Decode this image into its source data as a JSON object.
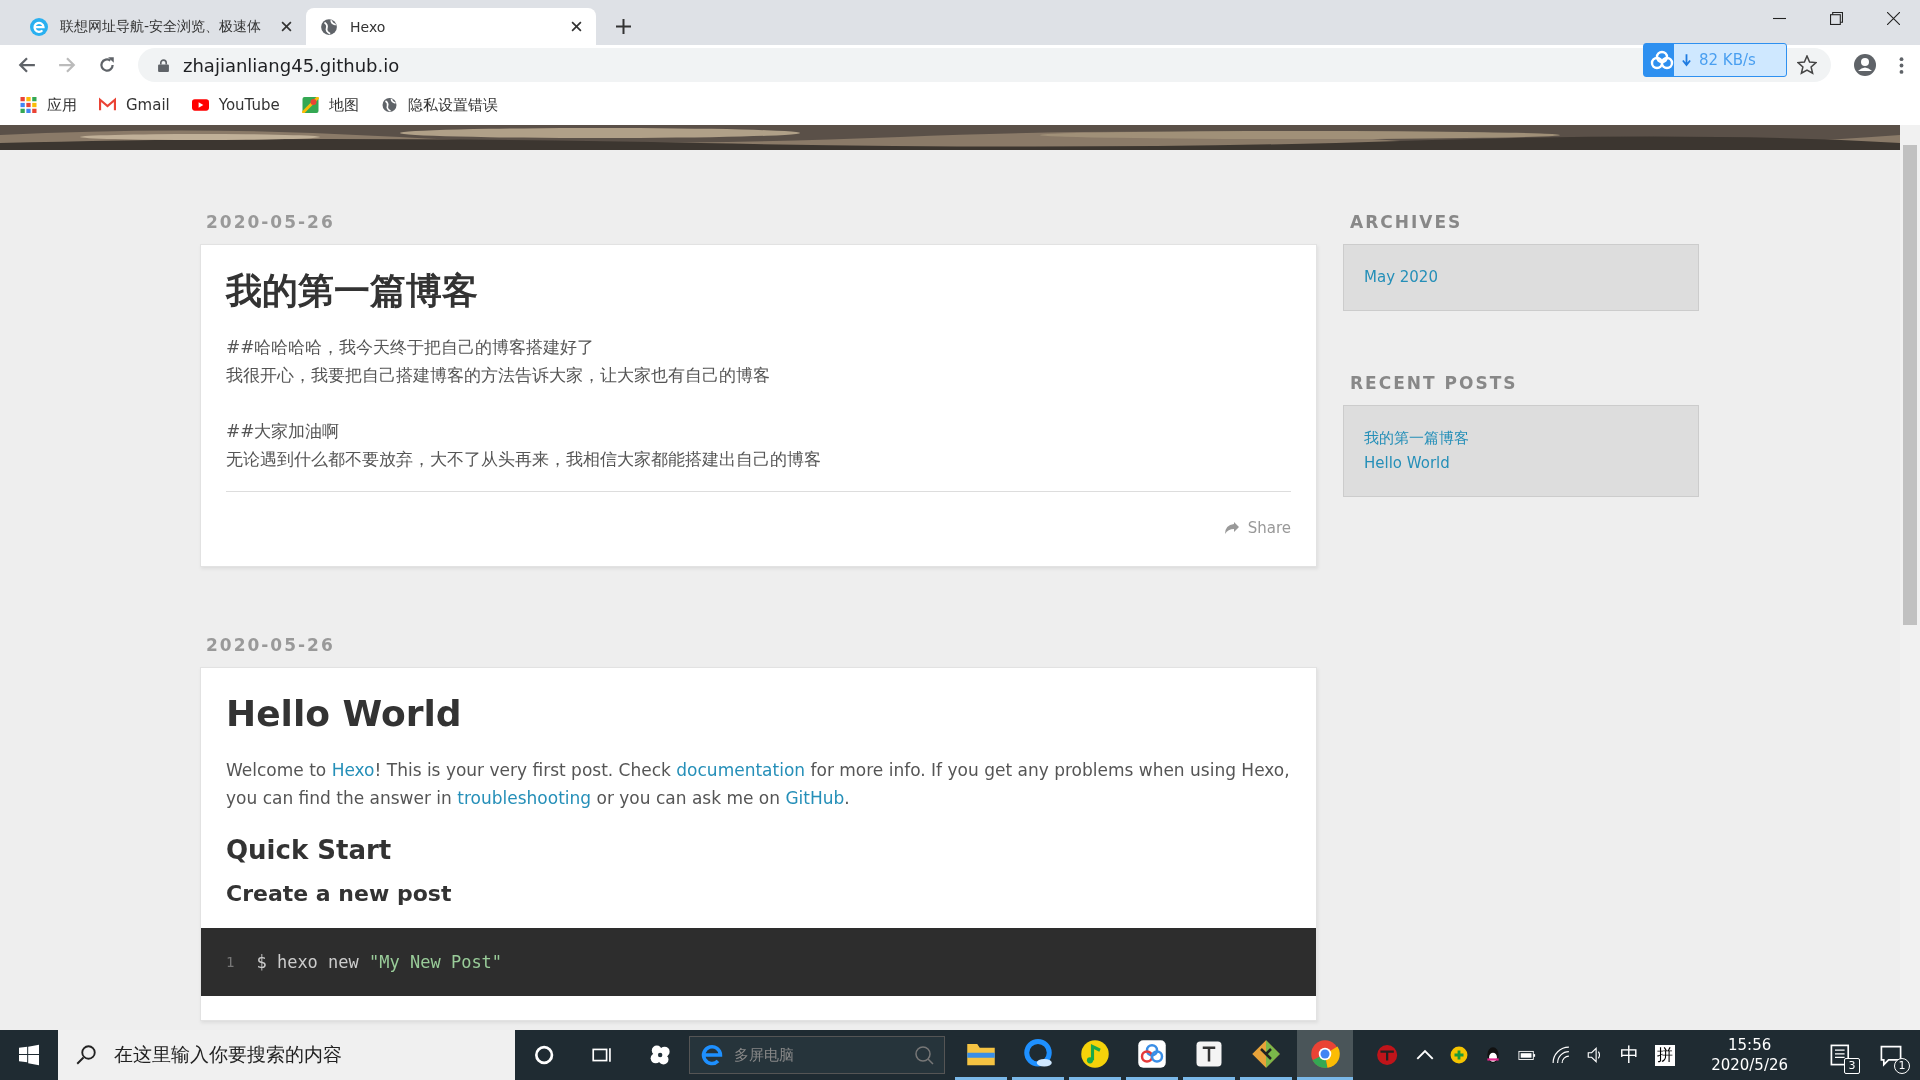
{
  "browser": {
    "tabs": [
      {
        "title": "联想网址导航-安全浏览、极速体",
        "selected": false
      },
      {
        "title": "Hexo",
        "selected": true
      }
    ],
    "url": "zhajianliang45.github.io",
    "download_speed": "82 KB/s",
    "bookmarks": [
      {
        "label": "应用",
        "kind": "apps"
      },
      {
        "label": "Gmail",
        "kind": "mail"
      },
      {
        "label": "YouTube",
        "kind": "video"
      },
      {
        "label": "地图",
        "kind": "map"
      },
      {
        "label": "隐私设置错误",
        "kind": "site"
      }
    ]
  },
  "posts": [
    {
      "date": "2020-05-26",
      "title": "我的第一篇博客",
      "share": "Share",
      "blocks": [
        {
          "kind": "lines",
          "lines": [
            "##哈哈哈哈，我今天终于把自己的博客搭建好了",
            "我很开心，我要把自己搭建博客的方法告诉大家，让大家也有自己的博客"
          ]
        },
        {
          "kind": "lines",
          "lines": [
            "##大家加油啊",
            "无论遇到什么都不要放弃，大不了从头再来，我相信大家都能搭建出自己的博客"
          ]
        }
      ]
    },
    {
      "date": "2020-05-26",
      "title": "Hello World",
      "blocks": [
        {
          "kind": "paragraph",
          "parts": [
            {
              "kind": "text",
              "text": "Welcome to "
            },
            {
              "kind": "link",
              "text": "Hexo"
            },
            {
              "kind": "text",
              "text": "! This is your very first post. Check "
            },
            {
              "kind": "link",
              "text": "documentation"
            },
            {
              "kind": "text",
              "text": " for more info. If you get any problems when using Hexo, you can find the answer in "
            },
            {
              "kind": "link",
              "text": "troubleshooting"
            },
            {
              "kind": "text",
              "text": " or you can ask me on "
            },
            {
              "kind": "link",
              "text": "GitHub"
            },
            {
              "kind": "text",
              "text": "."
            }
          ]
        },
        {
          "kind": "h2",
          "text": "Quick Start"
        },
        {
          "kind": "h3",
          "text": "Create a new post"
        },
        {
          "kind": "code",
          "line": "1",
          "command": "$ hexo new ",
          "string": "\"My New Post\""
        }
      ]
    }
  ],
  "sidebar": [
    {
      "title": "ARCHIVES",
      "links": [
        "May 2020"
      ]
    },
    {
      "title": "RECENT POSTS",
      "links": [
        "我的第一篇博客",
        "Hello World"
      ]
    }
  ],
  "taskbar": {
    "search_placeholder": "在这里输入你要搜索的内容",
    "widget_placeholder": "多屏电脑",
    "apps": [
      {
        "kind": "folder",
        "selected": false
      },
      {
        "kind": "browser",
        "selected": false
      },
      {
        "kind": "music",
        "selected": false
      },
      {
        "kind": "cloud",
        "selected": false
      },
      {
        "kind": "text",
        "selected": false
      },
      {
        "kind": "git",
        "selected": false
      },
      {
        "kind": "chrome",
        "selected": true
      }
    ],
    "ime": "中",
    "ime_mode": "拼",
    "time": "15:56",
    "date": "2020/5/26",
    "tablet_badge": "3",
    "notification_badge": "1"
  }
}
